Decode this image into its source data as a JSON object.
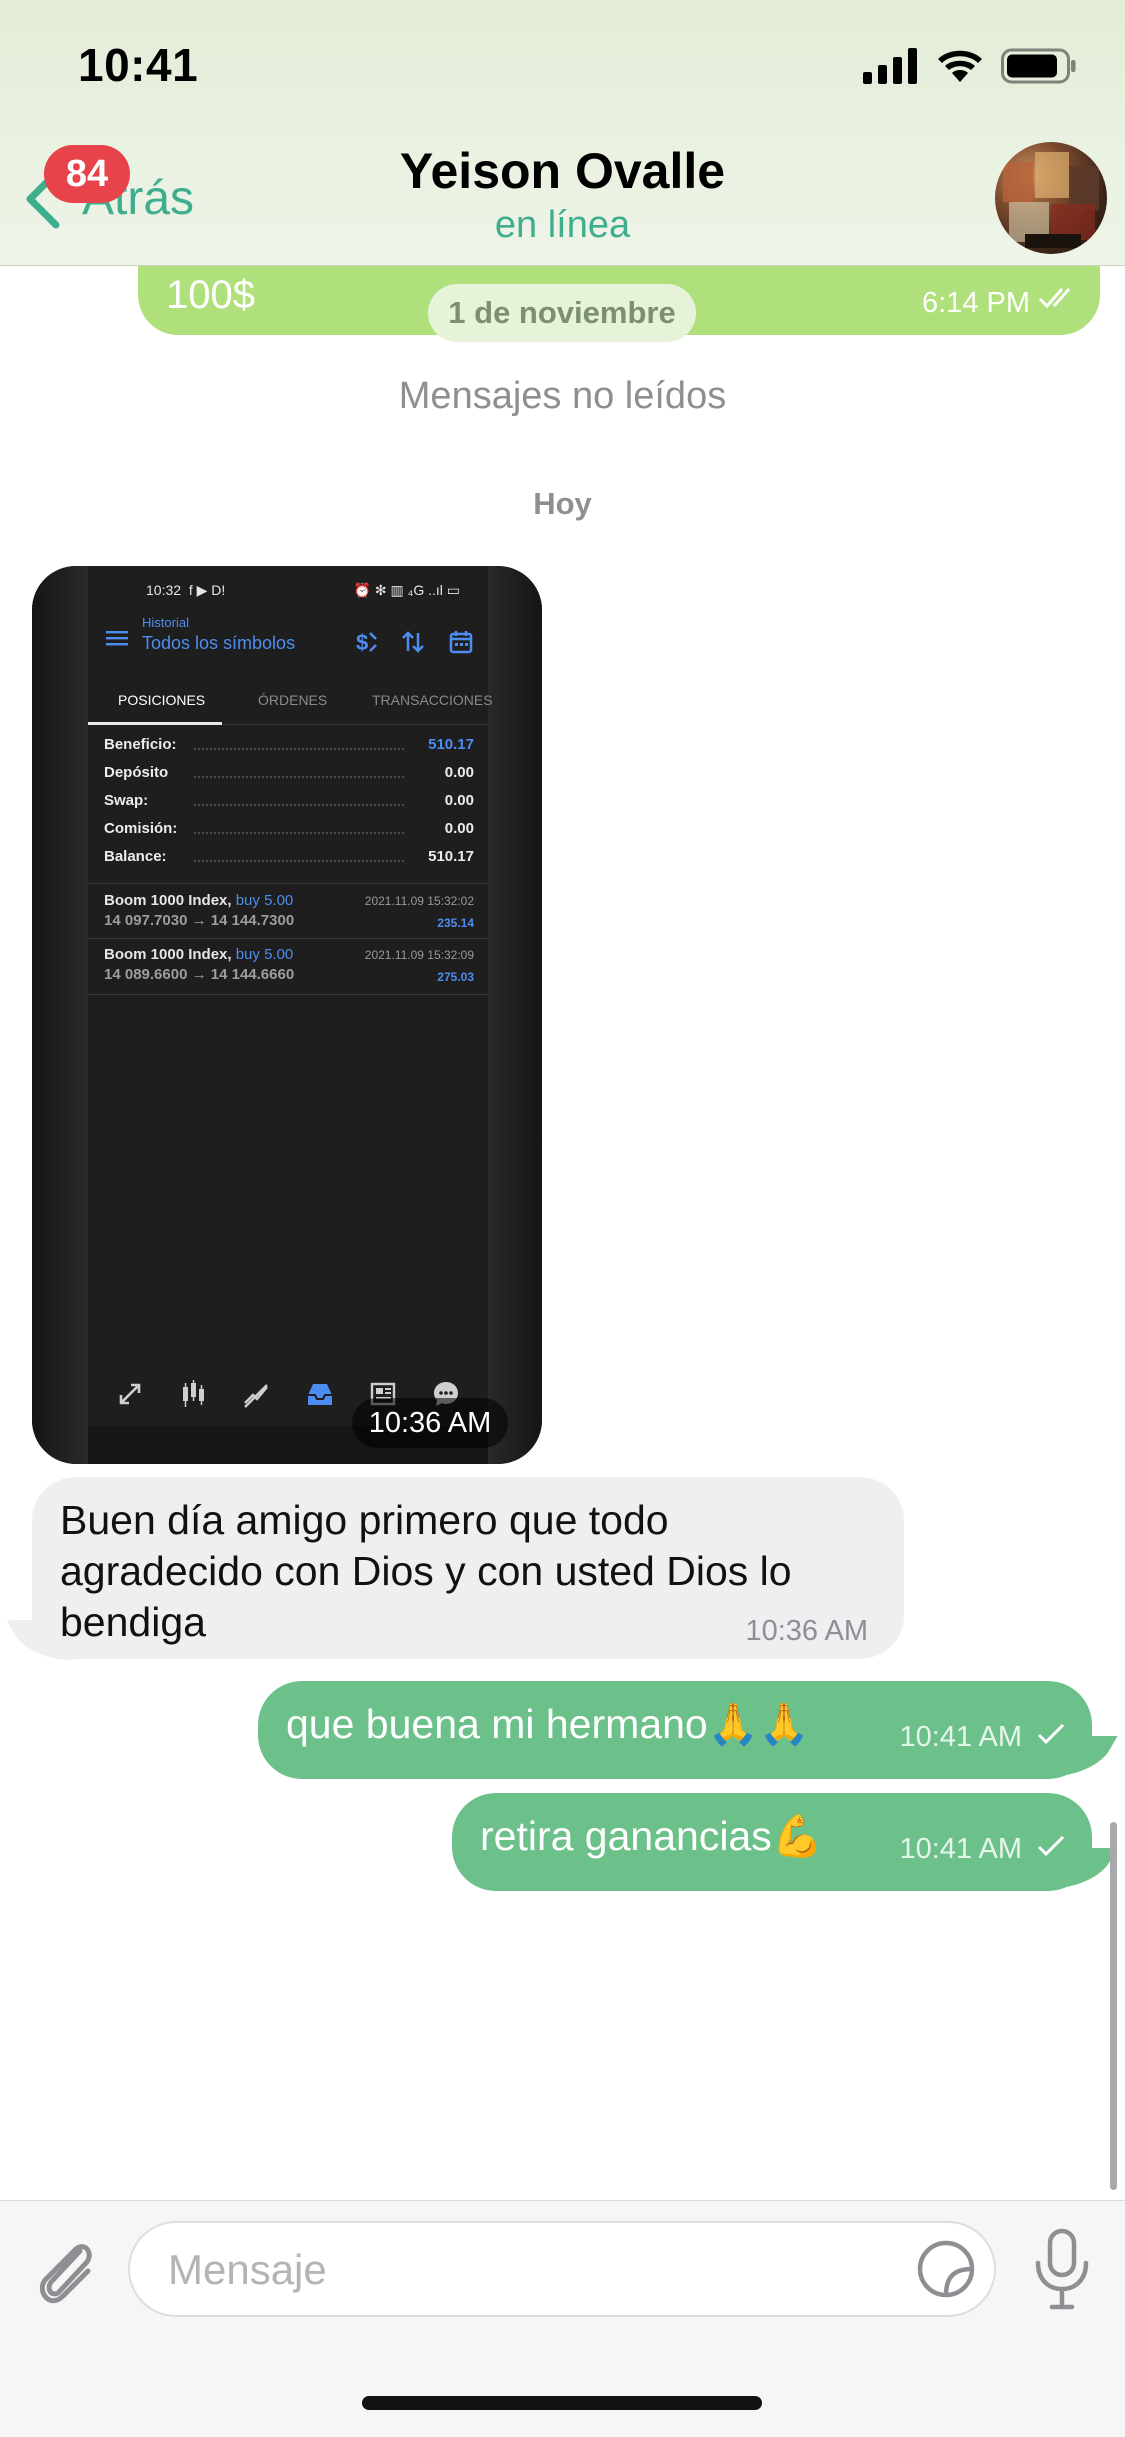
{
  "status_bar": {
    "time": "10:41"
  },
  "header": {
    "back_label": "Atrás",
    "unread_badge": "84",
    "contact_name": "Yeison Ovalle",
    "contact_status": "en línea"
  },
  "chat": {
    "previous_message": {
      "text": "100$",
      "time": "6:14 PM",
      "ticks": "double"
    },
    "date_label": "1 de noviembre",
    "unread_divider": "Mensajes no leídos",
    "day_label": "Hoy",
    "image_message": {
      "time": "10:36 AM",
      "screenshot": {
        "status_time": "10:32",
        "status_left_icons": "f ▶ D!",
        "status_right": "⏰ ✻ ▥ ₄G ..ıl ▭",
        "header_small": "Historial",
        "header_title": "Todos los símbolos",
        "tabs": [
          "POSICIONES",
          "ÓRDENES",
          "TRANSACCIONES"
        ],
        "summary": [
          {
            "label": "Beneficio:",
            "value": "510.17",
            "highlight": true
          },
          {
            "label": "Depósito",
            "value": "0.00",
            "highlight": false
          },
          {
            "label": "Swap:",
            "value": "0.00",
            "highlight": false
          },
          {
            "label": "Comisión:",
            "value": "0.00",
            "highlight": false
          },
          {
            "label": "Balance:",
            "value": "510.17",
            "highlight": false
          }
        ],
        "trades": [
          {
            "symbol": "Boom 1000 Index,",
            "side": "buy 5.00",
            "date": "2021.11.09 15:32:02",
            "prices": "14 097.7030 → 14 144.7300",
            "profit": "235.14"
          },
          {
            "symbol": "Boom 1000 Index,",
            "side": "buy 5.00",
            "date": "2021.11.09 15:32:09",
            "prices": "14 089.6600 → 14 144.6660",
            "profit": "275.03"
          }
        ],
        "bottom_nav": [
          "quotes-icon",
          "chart-icon",
          "trade-icon",
          "history-icon",
          "news-icon",
          "chat-icon"
        ],
        "accent": "#4d8df0"
      }
    },
    "incoming_text": {
      "lines": [
        "Buen día amigo primero que todo",
        "agradecido con Dios y con usted Dios lo",
        "bendiga"
      ],
      "time": "10:36 AM"
    },
    "outgoing": [
      {
        "text": "que buena mi hermano🙏🙏",
        "time": "10:41 AM",
        "ticks": "single"
      },
      {
        "text": "retira ganancias💪",
        "time": "10:41 AM",
        "ticks": "single"
      }
    ]
  },
  "input": {
    "placeholder": "Mensaje"
  },
  "colors": {
    "accent": "#3fae8f",
    "badge": "#e6434a",
    "outgoing_bubble": "#6cc08a",
    "previous_bubble": "#b0e07b",
    "incoming_bubble": "#efeff1"
  }
}
